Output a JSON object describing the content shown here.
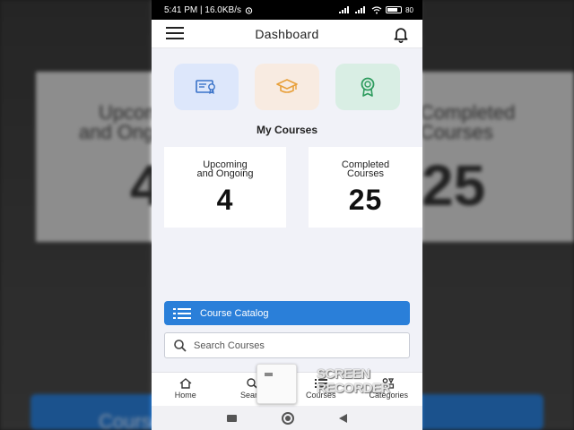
{
  "status_bar": {
    "left_text": "5:41 PM | 16.0KB/s",
    "right_text": "80"
  },
  "header": {
    "title": "Dashboard"
  },
  "tiles": [
    {
      "icon": "certificate-icon",
      "color": "#dde7fb"
    },
    {
      "icon": "graduation-cap-icon",
      "color": "#f8ebe1"
    },
    {
      "icon": "award-ribbon-icon",
      "color": "#d9eee4"
    }
  ],
  "my_courses": {
    "title": "My Courses",
    "upcoming": {
      "label_line1": "Upcoming",
      "label_line2": "and Ongoing",
      "value": "4"
    },
    "completed": {
      "label_line1": "Completed",
      "label_line2": "Courses",
      "value": "25"
    }
  },
  "actions": {
    "catalog_label": "Course Catalog",
    "search_placeholder": "Search Courses"
  },
  "bottom_nav": [
    {
      "label": "Home",
      "icon": "home-icon"
    },
    {
      "label": "Search",
      "icon": "search-icon"
    },
    {
      "label": "Courses",
      "icon": "list-icon"
    },
    {
      "label": "Categories",
      "icon": "categories-icon"
    }
  ],
  "watermark": {
    "line1": "SCREEN",
    "line2": "RECORDER"
  },
  "colors": {
    "accent": "#2a7fd9",
    "background": "#f1f2f8"
  }
}
